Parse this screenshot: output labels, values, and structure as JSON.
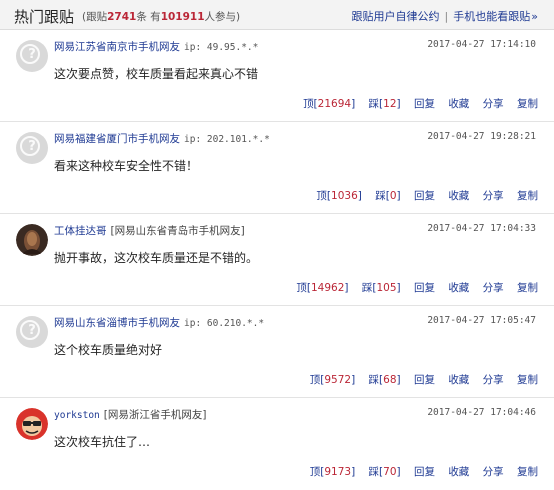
{
  "header": {
    "title": "热门跟贴",
    "stats_prefix": "(跟贴",
    "stats_count": "2741",
    "stats_mid": "条 有",
    "stats_people": "101911",
    "stats_suffix": "人参与)",
    "link_rules": "跟贴用户自律公约",
    "separator": "|",
    "link_mobile": "手机也能看跟贴",
    "chevron": "»"
  },
  "posts": [
    {
      "avatar": "default-avatar-icon",
      "user": "网易江苏省南京市手机网友",
      "ip": "ip: 49.95.*.*",
      "source": "",
      "time": "2017-04-27 17:14:10",
      "content": "这次要点赞，校车质量看起来真心不错",
      "up_label": "顶[",
      "up_count": "21694",
      "down_label": "踩[",
      "down_count": "12",
      "close": "]",
      "reply": "回复",
      "collect": "收藏",
      "share": "分享",
      "copy": "复制"
    },
    {
      "avatar": "default-avatar-icon",
      "user": "网易福建省厦门市手机网友",
      "ip": "ip: 202.101.*.*",
      "source": "",
      "time": "2017-04-27 19:28:21",
      "content": "看来这种校车安全性不错！",
      "up_label": "顶[",
      "up_count": "1036",
      "down_label": "踩[",
      "down_count": "0",
      "close": "]",
      "reply": "回复",
      "collect": "收藏",
      "share": "分享",
      "copy": "复制"
    },
    {
      "avatar": "photo-avatar-icon",
      "user": "工体挂达哥",
      "ip": "",
      "source": "[网易山东省青岛市手机网友]",
      "time": "2017-04-27 17:04:33",
      "content": "抛开事故，这次校车质量还是不错的。",
      "up_label": "顶[",
      "up_count": "14962",
      "down_label": "踩[",
      "down_count": "105",
      "close": "]",
      "reply": "回复",
      "collect": "收藏",
      "share": "分享",
      "copy": "复制"
    },
    {
      "avatar": "default-avatar-icon",
      "user": "网易山东省淄博市手机网友",
      "ip": "ip: 60.210.*.*",
      "source": "",
      "time": "2017-04-27 17:05:47",
      "content": "这个校车质量绝对好",
      "up_label": "顶[",
      "up_count": "9572",
      "down_label": "踩[",
      "down_count": "68",
      "close": "]",
      "reply": "回复",
      "collect": "收藏",
      "share": "分享",
      "copy": "复制"
    },
    {
      "avatar": "cartoon-avatar-icon",
      "user": "yorkston",
      "ip": "",
      "source": "[网易浙江省手机网友]",
      "time": "2017-04-27 17:04:46",
      "content": "这次校车抗住了…",
      "up_label": "顶[",
      "up_count": "9173",
      "down_label": "踩[",
      "down_count": "70",
      "close": "]",
      "reply": "回复",
      "collect": "收藏",
      "share": "分享",
      "copy": "复制"
    }
  ]
}
